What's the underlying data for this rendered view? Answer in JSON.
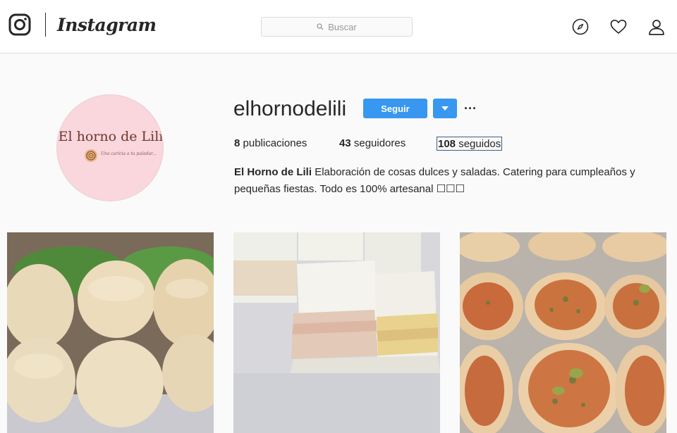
{
  "nav": {
    "brand": "Instagram",
    "search_placeholder": "Buscar",
    "icons": [
      "instagram-glyph-icon",
      "search-icon",
      "compass-icon",
      "heart-icon",
      "user-icon"
    ]
  },
  "profile": {
    "username": "elhornodelili",
    "follow_label": "Seguir",
    "more_label": "···",
    "avatar": {
      "title": "El horno de Lili",
      "tagline": "Una caricia a tu paladar..."
    },
    "stats": {
      "posts_count": "8",
      "posts_label": "publicaciones",
      "followers_count": "43",
      "followers_label": "seguidores",
      "following_count": "108",
      "following_label": "seguidos"
    },
    "bio": {
      "name": "El Horno de Lili",
      "text": "Elaboración de cosas dulces y saladas. Catering para cumpleaños y pequeñas fiestas. Todo es 100% artesanal ☐☐☐"
    }
  },
  "posts": [
    {
      "subject": "sandwiches-de-miga-bread-rolls"
    },
    {
      "subject": "sandwiches-de-miga-ham-cheese"
    },
    {
      "subject": "pizzetas-with-olives"
    }
  ],
  "colors": {
    "accent": "#3897f0",
    "background": "#fafafa",
    "avatar_pink": "#fad6dd"
  }
}
